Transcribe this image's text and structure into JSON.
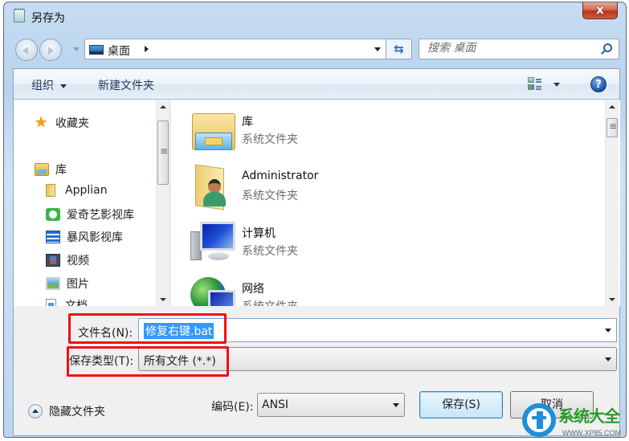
{
  "window": {
    "title": "另存为",
    "close_label": "x"
  },
  "nav": {
    "address_path": "桌面",
    "search_placeholder": "搜索 桌面",
    "refresh_glyph": "⇆"
  },
  "toolbar": {
    "organize_label": "组织",
    "new_folder_label": "新建文件夹",
    "help_glyph": "?"
  },
  "sidebar": {
    "favorites_label": "收藏夹",
    "library_label": "库",
    "items": [
      {
        "label": "Applian",
        "icon": "folder-icon"
      },
      {
        "label": "爱奇艺影视库",
        "icon": "iqiyi-icon"
      },
      {
        "label": "暴风影视库",
        "icon": "storm-icon"
      },
      {
        "label": "视频",
        "icon": "video-icon"
      },
      {
        "label": "图片",
        "icon": "picture-icon"
      },
      {
        "label": "文档",
        "icon": "document-icon"
      }
    ]
  },
  "files": [
    {
      "name": "库",
      "type": "系统文件夹",
      "icon": "library-icon"
    },
    {
      "name": "Administrator",
      "type": "系统文件夹",
      "icon": "user-folder-icon"
    },
    {
      "name": "计算机",
      "type": "系统文件夹",
      "icon": "computer-icon"
    },
    {
      "name": "网络",
      "type": "系统文件夹",
      "icon": "network-icon"
    }
  ],
  "form": {
    "filename_label": "文件名(N):",
    "filename_value": "修复右键.bat",
    "filetype_label": "保存类型(T):",
    "filetype_value": "所有文件  (*.*)",
    "hide_folders_label": "隐藏文件夹",
    "encoding_label": "编码(E):",
    "encoding_value": "ANSI",
    "save_label": "保存(S)",
    "cancel_label": "取消"
  },
  "annotations": {
    "highlight_color": "#f20f12"
  },
  "watermark": {
    "brand": "系统大全",
    "url": "WWW.XP85.COM"
  }
}
